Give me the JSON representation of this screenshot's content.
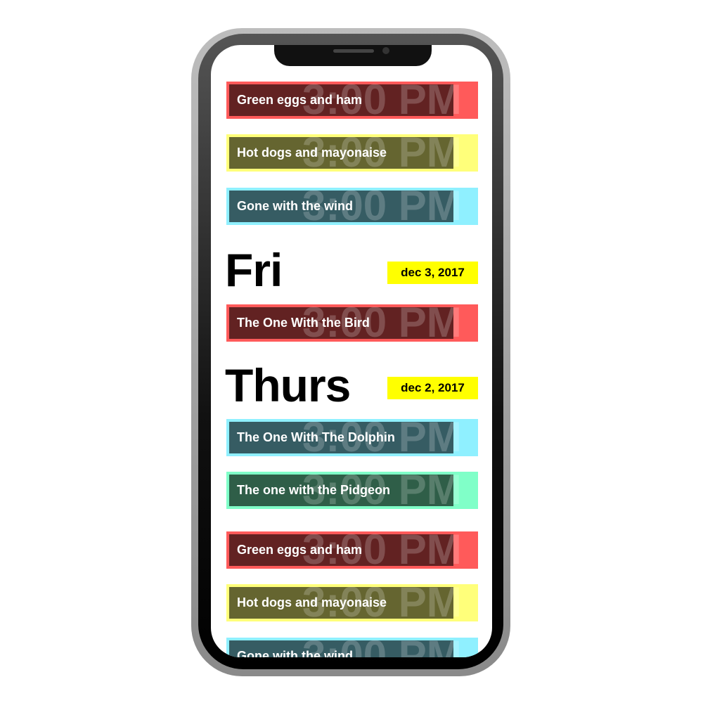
{
  "colors": {
    "red": [
      "#ff5a5a",
      "#622222"
    ],
    "yellow": [
      "#ffff7a",
      "#656530"
    ],
    "cyan": [
      "#8ff0ff",
      "#365c63"
    ],
    "green": [
      "#80ffc8",
      "#2f5e48"
    ],
    "badge": "#ffff00"
  },
  "time_label": "3:00 PM",
  "top_items": [
    {
      "title": "Green eggs and ham",
      "color": "red"
    },
    {
      "title": "Hot dogs and mayonaise",
      "color": "yellow"
    },
    {
      "title": "Gone with the wind",
      "color": "cyan"
    }
  ],
  "days": [
    {
      "day": "Fri",
      "date": "dec 3, 2017",
      "items": [
        {
          "title": "The One With the Bird",
          "color": "red"
        }
      ]
    },
    {
      "day": "Thurs",
      "date": "dec 2, 2017",
      "items": [
        {
          "title": "The One With The Dolphin",
          "color": "cyan"
        },
        {
          "title": "The one with the Pidgeon",
          "color": "green"
        },
        {
          "title": "Green eggs and ham",
          "color": "red"
        },
        {
          "title": "Hot dogs and mayonaise",
          "color": "yellow"
        },
        {
          "title": "Gone with the wind",
          "color": "cyan"
        }
      ]
    }
  ]
}
